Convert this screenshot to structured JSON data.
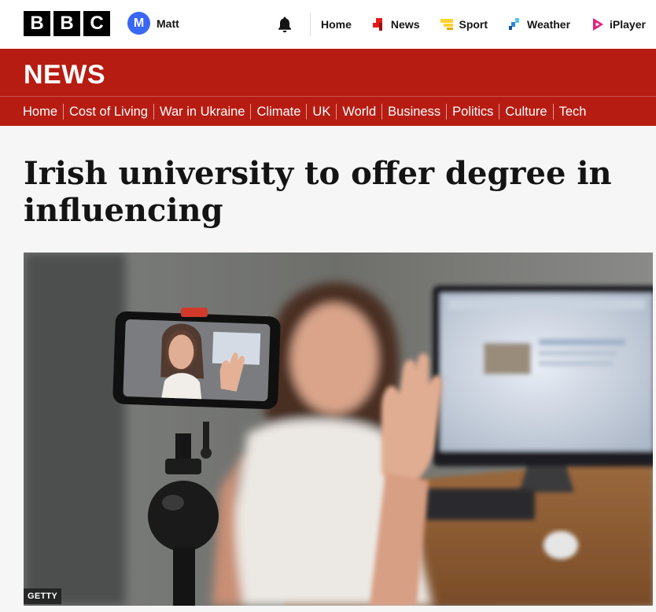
{
  "topbar": {
    "logo_letters": [
      "B",
      "B",
      "C"
    ],
    "account": {
      "initial": "M",
      "name": "Matt",
      "avatar_color": "#3a67f3"
    },
    "notifications_icon": "bell-icon",
    "nav": [
      {
        "label": "Home",
        "icon": null
      },
      {
        "label": "News",
        "icon": "news-icon",
        "color": "#e81a1a"
      },
      {
        "label": "Sport",
        "icon": "sport-icon",
        "color": "#ffd230"
      },
      {
        "label": "Weather",
        "icon": "weather-icon",
        "color": "#2e86de"
      },
      {
        "label": "iPlayer",
        "icon": "iplayer-icon",
        "color": "#e4207b"
      }
    ]
  },
  "masthead": {
    "title": "NEWS",
    "color": "#b71c12"
  },
  "section_nav": [
    "Home",
    "Cost of Living",
    "War in Ukraine",
    "Climate",
    "UK",
    "World",
    "Business",
    "Politics",
    "Culture",
    "Tech"
  ],
  "article": {
    "headline": "Irish university to offer degree in influencing",
    "image": {
      "credit": "GETTY",
      "subject": "woman-waving-at-phone-on-tripod"
    }
  }
}
